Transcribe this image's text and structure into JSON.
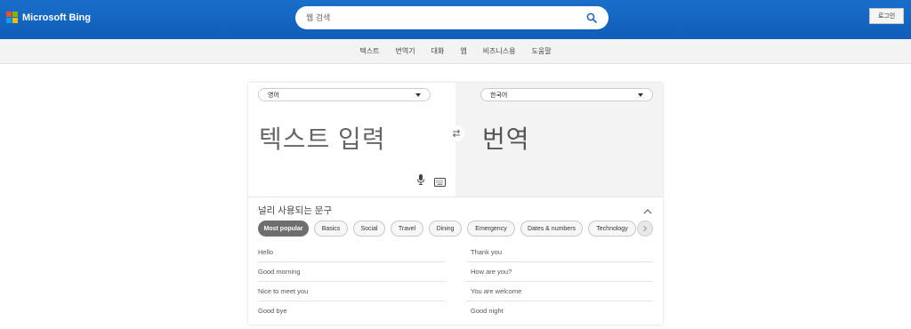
{
  "header": {
    "brand": "Microsoft Bing",
    "search_placeholder": "웹 검색",
    "login_label": "로그인"
  },
  "nav": {
    "items": [
      "텍스트",
      "번역기",
      "대화",
      "앱",
      "비즈니스용",
      "도움말"
    ]
  },
  "translator": {
    "source_language": "영어",
    "target_language": "한국어",
    "input_placeholder": "텍스트 입력",
    "output_placeholder": "번역"
  },
  "phrases": {
    "title": "널리 사용되는 문구",
    "categories": [
      "Most popular",
      "Basics",
      "Social",
      "Travel",
      "Dining",
      "Emergency",
      "Dates & numbers",
      "Technology"
    ],
    "active_category": "Most popular",
    "left_column": [
      "Hello",
      "Good morning",
      "Nice to meet you",
      "Good bye"
    ],
    "right_column": [
      "Thank you",
      "How are you?",
      "You are welcome",
      "Good night"
    ]
  },
  "colors": {
    "header_blue": "#1a6fc9",
    "active_chip": "#6e6e6e",
    "search_icon": "#1565c0"
  },
  "icons": {
    "search": "search-icon",
    "swap": "swap-icon",
    "mic": "microphone-icon",
    "keyboard": "keyboard-icon",
    "collapse": "chevron-up-icon",
    "next": "chevron-right-icon"
  }
}
